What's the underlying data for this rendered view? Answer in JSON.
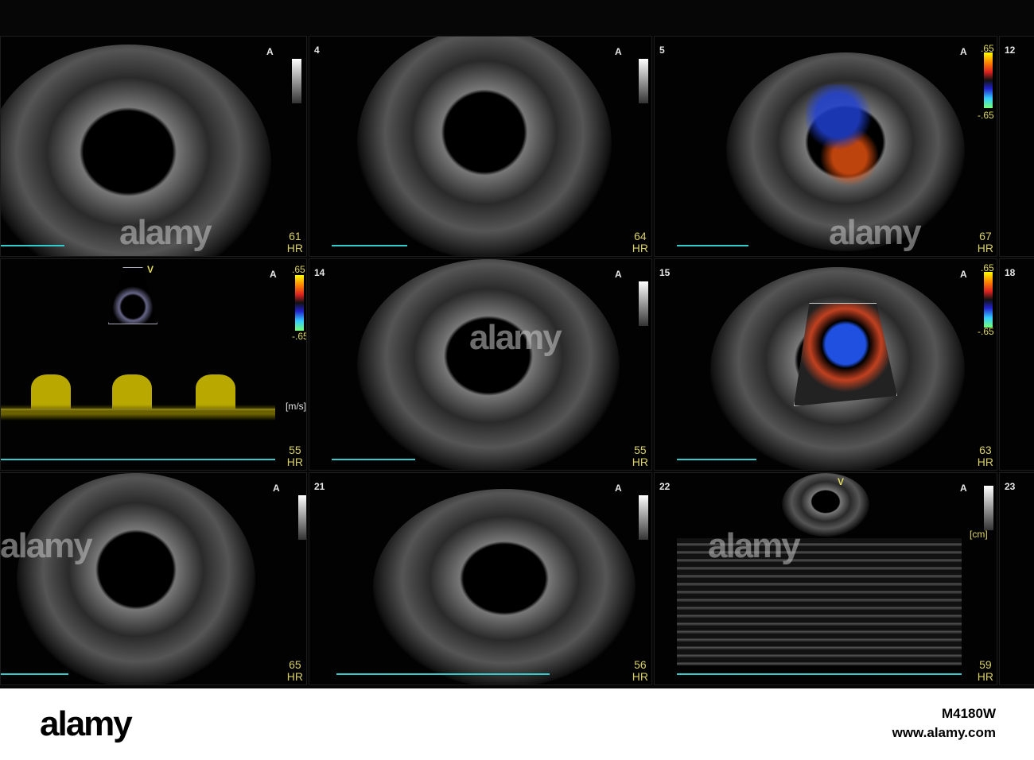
{
  "panels": [
    {
      "number": "",
      "orient": "A",
      "hr": "61",
      "hr_label": "HR"
    },
    {
      "number": "4",
      "orient": "A",
      "hr": "64",
      "hr_label": "HR"
    },
    {
      "number": "5",
      "orient": "A",
      "hr": "67",
      "hr_label": "HR",
      "scale_top": ".65",
      "scale_bottom": "-.65"
    },
    {
      "number": "",
      "orient": "A",
      "hr": "55",
      "hr_label": "HR",
      "scale_top": ".65",
      "scale_bottom": "-.65",
      "unit": "[m/s]",
      "mode": "V"
    },
    {
      "number": "14",
      "orient": "A",
      "hr": "55",
      "hr_label": "HR"
    },
    {
      "number": "15",
      "orient": "A",
      "hr": "63",
      "hr_label": "HR",
      "scale_top": ".65",
      "scale_bottom": "-.65"
    },
    {
      "number": "",
      "orient": "A",
      "hr": "65",
      "hr_label": "HR"
    },
    {
      "number": "21",
      "orient": "A",
      "hr": "56",
      "hr_label": "HR"
    },
    {
      "number": "22",
      "orient": "A",
      "hr": "59",
      "hr_label": "HR",
      "unit": "[cm]",
      "mode": "V"
    }
  ],
  "edge_numbers": [
    "12",
    "18",
    "23"
  ],
  "watermark": "alamy",
  "footer": {
    "logo": "alamy",
    "image_id": "M4180W",
    "url": "www.alamy.com"
  },
  "colors": {
    "hr_text": "#d8cf6a",
    "ecg": "#33cccc",
    "doppler": "#e0d800"
  }
}
